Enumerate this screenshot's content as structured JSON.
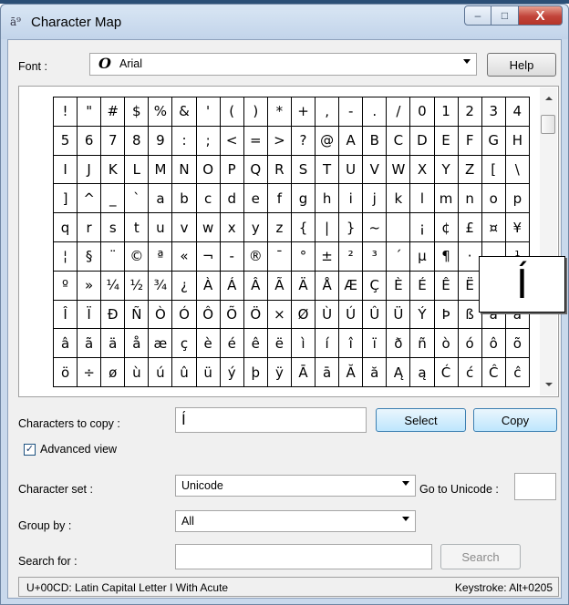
{
  "window": {
    "title": "Character Map",
    "controls": {
      "minimize": "–",
      "maximize": "□",
      "close": "X"
    }
  },
  "font": {
    "label": "Font :",
    "value": "Arial",
    "icon": "O"
  },
  "help_label": "Help",
  "grid": {
    "rows": [
      [
        "!",
        "\"",
        "#",
        "$",
        "%",
        "&",
        "'",
        "(",
        ")",
        "*",
        "+",
        ",",
        "-",
        ".",
        "/",
        "0",
        "1",
        "2",
        "3",
        "4"
      ],
      [
        "5",
        "6",
        "7",
        "8",
        "9",
        ":",
        ";",
        "<",
        "=",
        ">",
        "?",
        "@",
        "A",
        "B",
        "C",
        "D",
        "E",
        "F",
        "G",
        "H"
      ],
      [
        "I",
        "J",
        "K",
        "L",
        "M",
        "N",
        "O",
        "P",
        "Q",
        "R",
        "S",
        "T",
        "U",
        "V",
        "W",
        "X",
        "Y",
        "Z",
        "[",
        "\\"
      ],
      [
        "]",
        "^",
        "_",
        "`",
        "a",
        "b",
        "c",
        "d",
        "e",
        "f",
        "g",
        "h",
        "i",
        "j",
        "k",
        "l",
        "m",
        "n",
        "o",
        "p"
      ],
      [
        "q",
        "r",
        "s",
        "t",
        "u",
        "v",
        "w",
        "x",
        "y",
        "z",
        "{",
        "|",
        "}",
        "~",
        " ",
        "¡",
        "¢",
        "£",
        "¤",
        "¥"
      ],
      [
        "¦",
        "§",
        "¨",
        "©",
        "ª",
        "«",
        "¬",
        "-",
        "®",
        "¯",
        "°",
        "±",
        "²",
        "³",
        "´",
        "µ",
        "¶",
        "·",
        "¸",
        "¹"
      ],
      [
        "º",
        "»",
        "¼",
        "½",
        "¾",
        "¿",
        "À",
        "Á",
        "Â",
        "Ã",
        "Ä",
        "Å",
        "Æ",
        "Ç",
        "È",
        "É",
        "Ê",
        "Ë",
        "Ì",
        "Í"
      ],
      [
        "Î",
        "Ï",
        "Ð",
        "Ñ",
        "Ò",
        "Ó",
        "Ô",
        "Õ",
        "Ö",
        "×",
        "Ø",
        "Ù",
        "Ú",
        "Û",
        "Ü",
        "Ý",
        "Þ",
        "ß",
        "à",
        "á"
      ],
      [
        "â",
        "ã",
        "ä",
        "å",
        "æ",
        "ç",
        "è",
        "é",
        "ê",
        "ë",
        "ì",
        "í",
        "î",
        "ï",
        "ð",
        "ñ",
        "ò",
        "ó",
        "ô",
        "õ"
      ],
      [
        "ö",
        "÷",
        "ø",
        "ù",
        "ú",
        "û",
        "ü",
        "ý",
        "þ",
        "ÿ",
        "Ā",
        "ā",
        "Ă",
        "ă",
        "Ą",
        "ą",
        "Ć",
        "ć",
        "Ĉ",
        "ĉ"
      ]
    ],
    "magnified_char": "Í"
  },
  "copy": {
    "label": "Characters to copy :",
    "value": "Í",
    "select_label": "Select",
    "copy_label": "Copy"
  },
  "advanced_view": {
    "label": "Advanced view",
    "checked": true,
    "check_mark": "✓"
  },
  "character_set": {
    "label": "Character set :",
    "value": "Unicode"
  },
  "goto_unicode": {
    "label": "Go to Unicode :",
    "value": ""
  },
  "group_by": {
    "label": "Group by :",
    "value": "All"
  },
  "search": {
    "label": "Search for :",
    "value": "",
    "button_label": "Search"
  },
  "status": {
    "left": "U+00CD: Latin Capital Letter I With Acute",
    "right": "Keystroke: Alt+0205"
  }
}
